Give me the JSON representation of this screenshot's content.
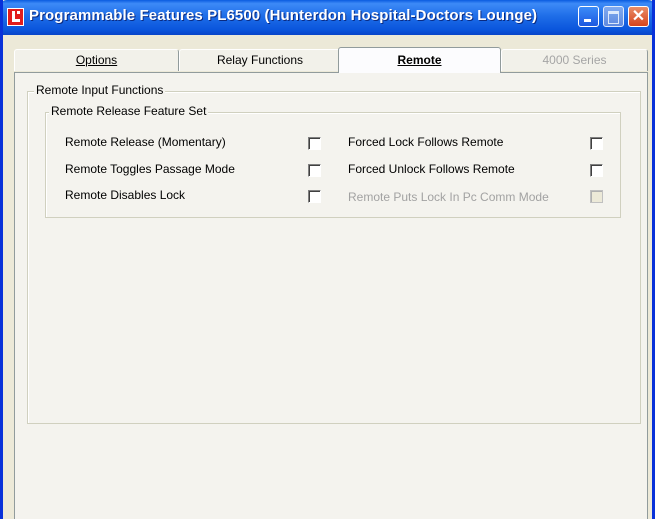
{
  "window": {
    "title": "Programmable Features PL6500 (Hunterdon Hospital-Doctors Lounge)",
    "controls": [
      "minimize-icon",
      "maximize-icon",
      "close-icon"
    ],
    "accent_color": "#0a55dc"
  },
  "tabs": [
    {
      "label": "Options",
      "active": false,
      "enabled": true
    },
    {
      "label": "Relay Functions",
      "active": false,
      "enabled": true
    },
    {
      "label": "Remote",
      "active": true,
      "enabled": true
    },
    {
      "label": "4000 Series",
      "active": false,
      "enabled": false
    }
  ],
  "remote": {
    "group_title": "Remote Input Functions",
    "subgroup_title": "Remote Release Feature Set",
    "options": [
      {
        "label": "Remote Release (Momentary)",
        "checked": false,
        "enabled": true
      },
      {
        "label": "Remote Toggles Passage Mode",
        "checked": false,
        "enabled": true
      },
      {
        "label": "Remote Disables Lock",
        "checked": false,
        "enabled": true
      },
      {
        "label": "Forced Lock Follows Remote",
        "checked": false,
        "enabled": true
      },
      {
        "label": "Forced Unlock Follows Remote",
        "checked": false,
        "enabled": true
      },
      {
        "label": "Remote Puts Lock In  Pc Comm Mode",
        "checked": false,
        "enabled": false
      }
    ]
  }
}
